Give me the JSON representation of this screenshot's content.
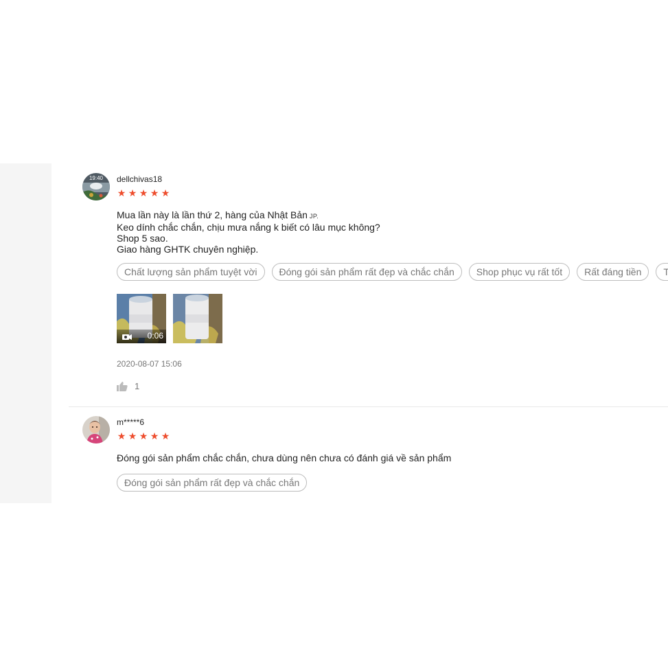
{
  "reviews": [
    {
      "username": "dellchivas18",
      "avatar_icon": "profile-photo",
      "avatar_time": "19:40",
      "rating": 5,
      "content_lines": [
        "Mua lần này là lần thứ 2, hàng của Nhật Bản",
        "Keo dính chắc chắn, chịu mưa nắng k biết có lâu mục không?",
        "Shop 5 sao.",
        "Giao hàng GHTK chuyên nghiệp."
      ],
      "content_tag": "JP.",
      "tags": [
        "Chất lượng sản phẩm tuyệt vời",
        "Đóng gói sản phẩm rất đẹp và chắc chắn",
        "Shop phục vụ rất tốt",
        "Rất đáng tiền",
        "T"
      ],
      "media": [
        {
          "type": "video",
          "duration": "0:06",
          "icon": "video-camera-icon"
        },
        {
          "type": "image"
        }
      ],
      "timestamp": "2020-08-07 15:06",
      "like_icon": "thumbs-up-icon",
      "likes": "1"
    },
    {
      "username": "m*****6",
      "avatar_icon": "profile-photo",
      "rating": 5,
      "content_lines": [
        "Đóng gói sản phẩm chắc chắn, chưa dùng nên chưa có đánh giá về sản phẩm"
      ],
      "tags": [
        "Đóng gói sản phẩm rất đẹp và chắc chắn"
      ]
    }
  ],
  "colors": {
    "star": "#ee4d2d",
    "tag_border": "#bcbcbc",
    "muted_text": "#777777",
    "gutter": "#f5f5f5"
  }
}
